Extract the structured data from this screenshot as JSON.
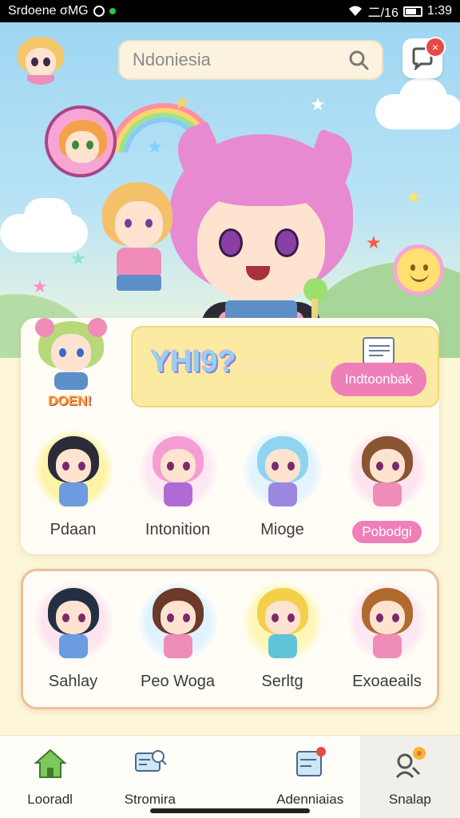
{
  "status_bar": {
    "left_text": "Srdoene σMG",
    "time": "1:39",
    "network": "⼆/16"
  },
  "search": {
    "placeholder": "Ndoniesia"
  },
  "chat": {
    "badge": "×"
  },
  "banner": {
    "title": "YHI9?",
    "faded_text": "NOONIESIE",
    "button_label": "Indtoonbak",
    "side_tag": "DOEN!"
  },
  "row1": [
    {
      "label": "Pdaan",
      "glow": "#fff3a8",
      "hair": "#2b2b3a",
      "outfit": "#6b9be0",
      "highlight": false
    },
    {
      "label": "Intonition",
      "glow": "#fde7f2",
      "hair": "#f59ed3",
      "outfit": "#b06ad4",
      "highlight": false
    },
    {
      "label": "Mioge",
      "glow": "#e3f3ff",
      "hair": "#8fd4f0",
      "outfit": "#9b87e0",
      "highlight": false
    },
    {
      "label": "Pobodgi",
      "glow": "#fde4ef",
      "hair": "#8a5533",
      "outfit": "#f08cb8",
      "highlight": true
    }
  ],
  "row2": [
    {
      "label": "Sahlay",
      "glow": "#fde4ef",
      "hair": "#233044",
      "outfit": "#6b9be0"
    },
    {
      "label": "Peo Woga",
      "glow": "#dff3ff",
      "hair": "#6b3a2a",
      "outfit": "#f08cb8"
    },
    {
      "label": "Serltg",
      "glow": "#fff6b8",
      "hair": "#f4d04a",
      "outfit": "#5fc4d9"
    },
    {
      "label": "Exoaeails",
      "glow": "#fde7f2",
      "hair": "#b06a2e",
      "outfit": "#f08cb8"
    }
  ],
  "nav": [
    {
      "label": "Looradl",
      "icon": "home-icon"
    },
    {
      "label": "Stromira",
      "icon": "search-monitor-icon"
    },
    {
      "label": "Adenniaias",
      "icon": "calendar-icon"
    },
    {
      "label": "Snalap",
      "icon": "profile-flower-icon"
    }
  ],
  "colors": {
    "accent_pink": "#ef7fb8",
    "banner_yellow": "#fbeaa2",
    "sky": "#9fd6f2",
    "badge_red": "#e94848"
  }
}
